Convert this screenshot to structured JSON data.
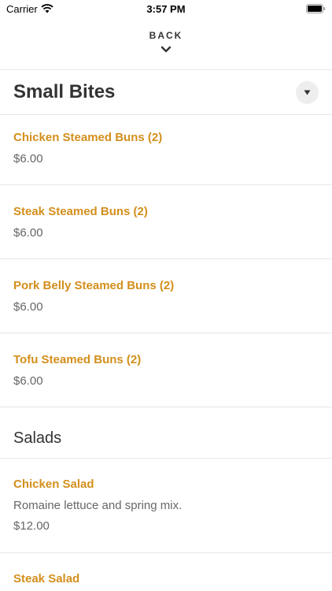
{
  "status_bar": {
    "carrier": "Carrier",
    "time": "3:57 PM"
  },
  "nav": {
    "back_label": "BACK"
  },
  "sections": [
    {
      "title": "Small Bites",
      "items": [
        {
          "name": "Chicken Steamed Buns (2)",
          "price": "$6.00"
        },
        {
          "name": "Steak Steamed Buns (2)",
          "price": "$6.00"
        },
        {
          "name": "Pork Belly  Steamed Buns (2)",
          "price": "$6.00"
        },
        {
          "name": "Tofu Steamed Buns (2)",
          "price": "$6.00"
        }
      ]
    },
    {
      "title": "Salads",
      "items": [
        {
          "name": "Chicken Salad",
          "description": "Romaine lettuce and spring mix.",
          "price": "$12.00"
        },
        {
          "name": "Steak Salad"
        }
      ]
    }
  ],
  "colors": {
    "accent": "#d38f1c",
    "text": "#333333",
    "muted": "#666666",
    "divider": "#e6e6e6"
  }
}
